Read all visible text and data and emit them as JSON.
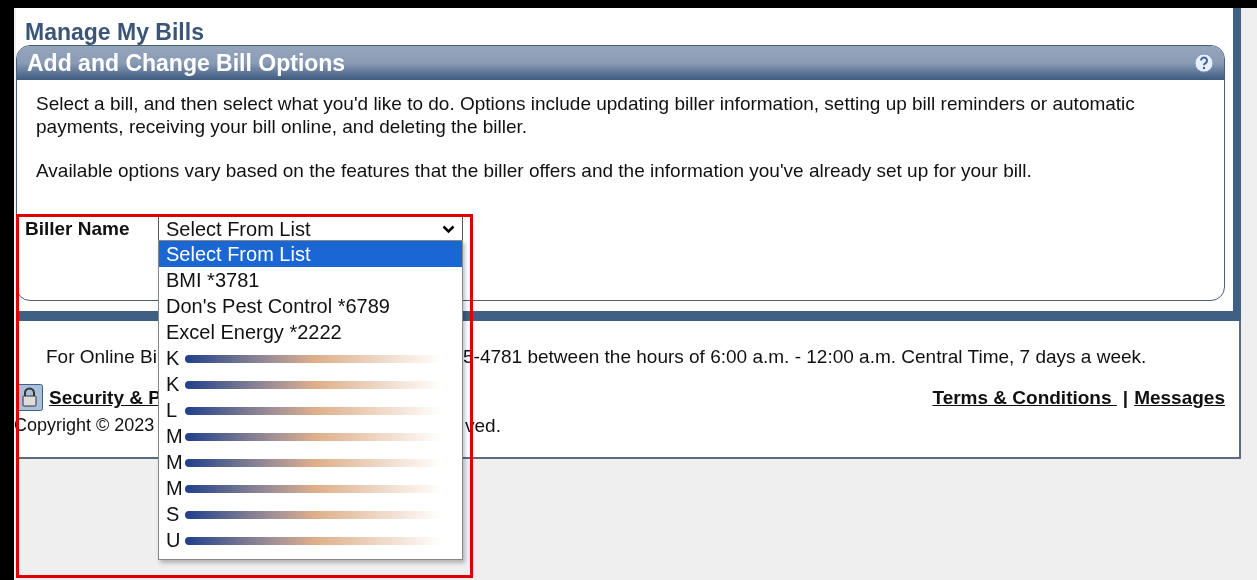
{
  "page_title": "Manage My Bills",
  "panel": {
    "title": "Add and Change Bill Options",
    "paragraphs": [
      "Select a bill, and then select what you'd like to do. Options include updating biller information, setting up bill reminders or automatic payments, receiving your bill online, and deleting the biller.",
      "Available options vary based on the features that the biller offers and the information you've already set up for your bill."
    ],
    "biller_label": "Biller Name",
    "biller_select": {
      "value": "Select From List",
      "expanded": true,
      "options": [
        {
          "label": "Select From List",
          "kind": "plain",
          "selected": true
        },
        {
          "label": "BMI *3781",
          "kind": "plain",
          "selected": false
        },
        {
          "label": "Don's Pest Control *6789",
          "kind": "plain",
          "selected": false
        },
        {
          "label": "Excel Energy *2222",
          "kind": "plain",
          "selected": false
        },
        {
          "label": "K",
          "kind": "redacted",
          "selected": false
        },
        {
          "label": "K",
          "kind": "redacted",
          "selected": false
        },
        {
          "label": "L",
          "kind": "redacted",
          "selected": false
        },
        {
          "label": "M",
          "kind": "redacted",
          "selected": false
        },
        {
          "label": "M",
          "kind": "redacted",
          "selected": false
        },
        {
          "label": "M",
          "kind": "redacted",
          "selected": false
        },
        {
          "label": "S",
          "kind": "redacted",
          "selected": false
        },
        {
          "label": "U",
          "kind": "redacted",
          "selected": false
        }
      ]
    }
  },
  "footer": {
    "support_left": "For Online Bi",
    "support_right": "5-4781 between the hours of 6:00 a.m. - 12:00 a.m. Central Time, 7 days a week.",
    "security_link": "Security & P",
    "links": [
      "Terms & Conditions",
      "Messages"
    ],
    "separator": "|",
    "copyright_left": "Copyright © 2023",
    "copyright_right": "ved."
  }
}
